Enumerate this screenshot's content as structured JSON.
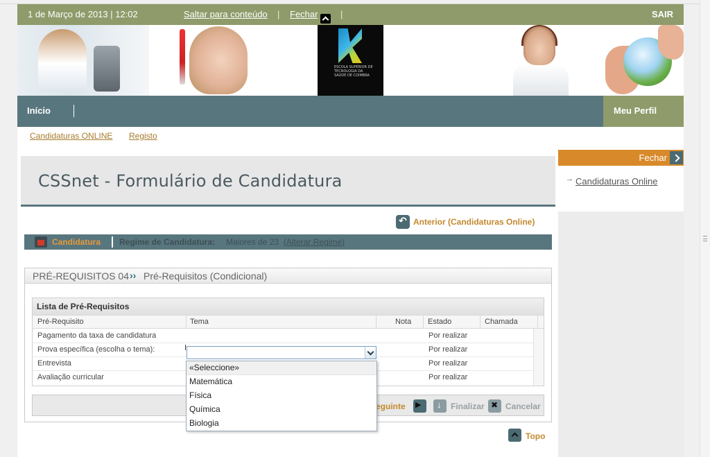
{
  "topbar": {
    "datetime": "1 de Março de 2013 | 12:02",
    "skip_link": "Saltar para conteúdo",
    "sep": "|",
    "close_label": "Fechar",
    "logout": "SAIR"
  },
  "banner": {
    "logo_text": "ESCOLA SUPERIOR DE TECNOLOGIA DA SAÚDE DE COIMBRA"
  },
  "nav": {
    "home": "Início",
    "profile": "Meu Perfil"
  },
  "subnav": {
    "items": [
      "Candidaturas ONLINE",
      "Registo"
    ]
  },
  "sidebar": {
    "close_label": "Fechar",
    "arrow": "→",
    "link": "Candidaturas Online"
  },
  "page": {
    "title": "CSSnet - Formulário de Candidatura",
    "back_link": "Anterior (Candidaturas Online)"
  },
  "regime": {
    "candidatura": "Candidatura",
    "label": "Regime de Candidatura:",
    "value": "Maiores de 23",
    "change_link": "(Alterar Regime)"
  },
  "panel": {
    "step": "PRÉ-REQUISITOS 04",
    "chevrons": "››",
    "step_title": "Pré-Requisitos (Condicional)"
  },
  "table": {
    "title": "Lista de Pré-Requisitos",
    "columns": [
      "Pré-Requisito",
      "Tema",
      "Nota",
      "Estado",
      "Chamada"
    ],
    "rows": [
      {
        "prereq": "Pagamento da taxa de candidatura",
        "estado": "Por realizar"
      },
      {
        "prereq": "Prova específica (escolha o tema):",
        "estado": "Por realizar"
      },
      {
        "prereq": "Entrevista",
        "estado": "Por realizar"
      },
      {
        "prereq": "Avaliação curricular",
        "estado": "Por realizar"
      }
    ]
  },
  "dropdown": {
    "value": "",
    "options": [
      "«Seleccione»",
      "Matemática",
      "Física",
      "Química",
      "Biologia"
    ]
  },
  "actions": {
    "next": "eguinte",
    "finish": "Finalizar",
    "cancel": "Cancelar"
  },
  "topo": "Topo",
  "colors": {
    "olive": "#8f9b6a",
    "teal": "#58767e",
    "accent": "#c4892f",
    "sidebar_orange": "#d88a2b"
  }
}
